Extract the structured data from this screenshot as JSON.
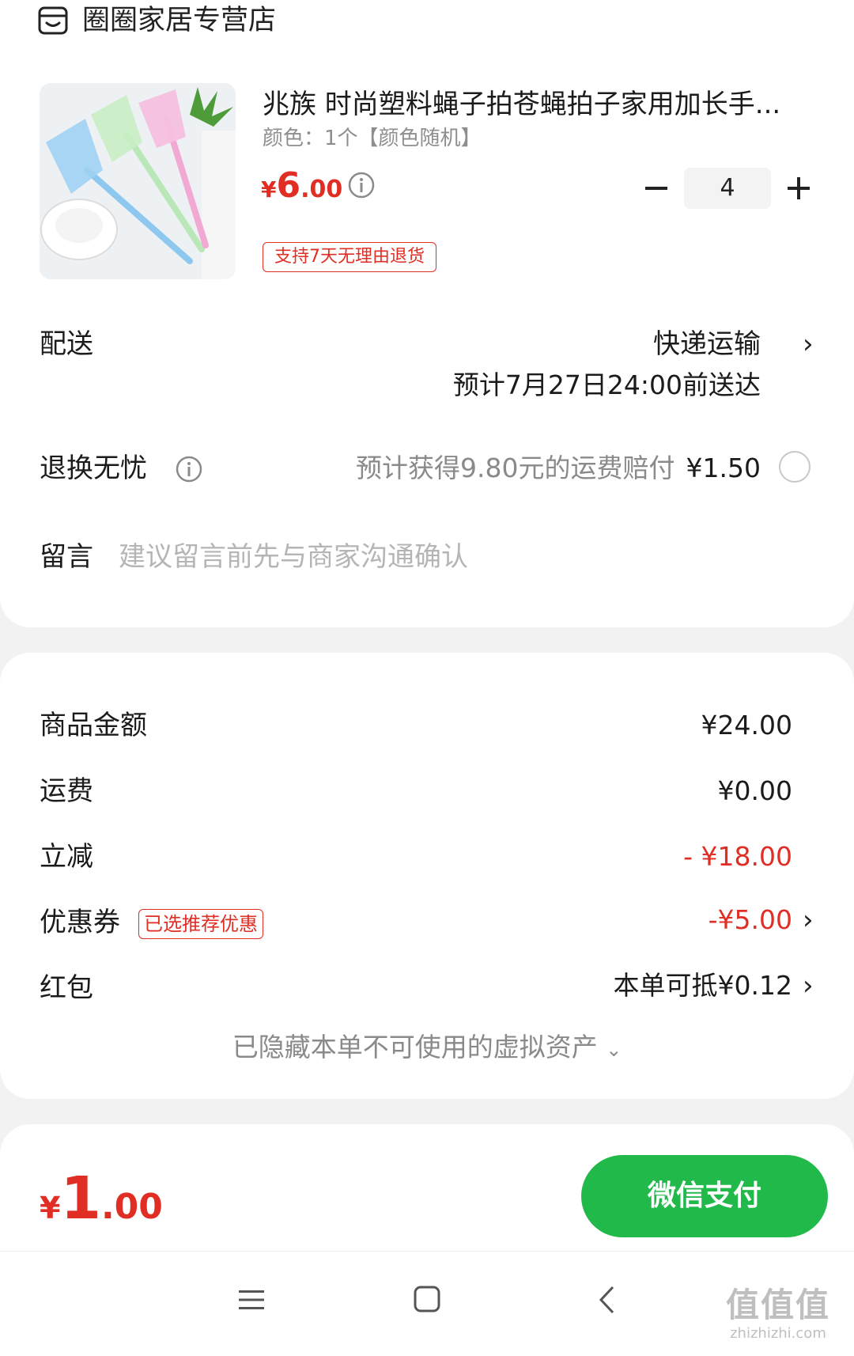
{
  "store": {
    "name": "圈圈家居专营店"
  },
  "product": {
    "title": "兆族 时尚塑料蝇子拍苍蝇拍子家用加长手...",
    "spec": "颜色：1个【颜色随机】",
    "price_currency": "¥",
    "price_int": "6",
    "price_dec": ".00",
    "quantity": "4",
    "return_badge": "支持7天无理由退货"
  },
  "delivery": {
    "label": "配送",
    "method": "快递运输",
    "estimate": "预计7月27日24:00前送达"
  },
  "return_insurance": {
    "label": "退换无忧",
    "info": "预计获得9.80元的运费赔付",
    "fee": "¥1.50"
  },
  "message": {
    "label": "留言",
    "placeholder": "建议留言前先与商家沟通确认"
  },
  "summary": {
    "goods_label": "商品金额",
    "goods_value": "¥24.00",
    "shipping_label": "运费",
    "shipping_value": "¥0.00",
    "discount_label": "立减",
    "discount_value": "- ¥18.00",
    "coupon_label": "优惠券",
    "coupon_badge": "已选推荐优惠",
    "coupon_value": "-¥5.00",
    "redpacket_label": "红包",
    "redpacket_value": "本单可抵¥0.12",
    "hidden_assets": "已隐藏本单不可使用的虚拟资产"
  },
  "footer": {
    "total_currency": "¥",
    "total_int": "1",
    "total_dec": ".00",
    "pay_button": "微信支付"
  },
  "watermark": {
    "big": "值值值",
    "small": "zhizhizhi.com"
  },
  "colors": {
    "accent_red": "#e02e24",
    "pay_green": "#21b94a"
  },
  "icons": [
    "store-icon",
    "info-icon",
    "minus-icon",
    "plus-icon",
    "chevron-right-icon",
    "chevron-down-icon",
    "menu-icon",
    "home-icon",
    "back-icon"
  ]
}
